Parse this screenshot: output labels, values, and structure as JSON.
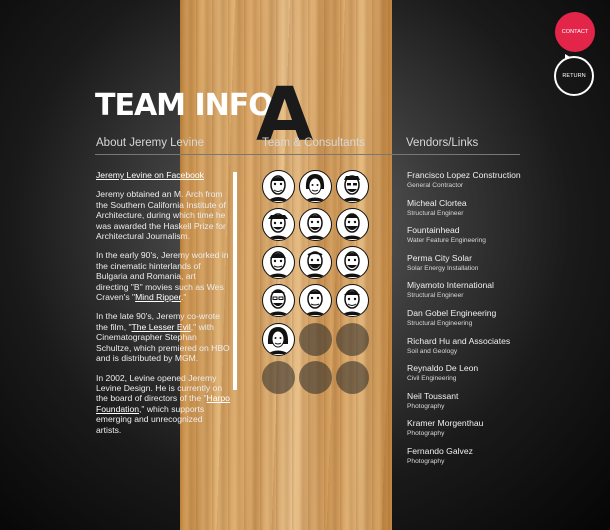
{
  "title": "TEAM INFO",
  "letter": "A",
  "columns": {
    "about": "About Jeremy Levine",
    "team": "Team & Consultants",
    "vendors": "Vendors/Links"
  },
  "about": {
    "facebook_link": "Jeremy Levine on Facebook",
    "p1": "Jeremy obtained an M. Arch from the Southern California Institute of Architecture, during which time he was awarded the Haskell Prize for Architectural Journalism.",
    "p2_a": "In the early 90's, Jeremy worked in the cinematic hinterlands of Bulgaria and Romania, art directing \"B\" movies such as Wes Craven's \"",
    "p2_link": "Mind Ripper",
    "p2_b": ".\"",
    "p3_a": "In the late 90's, Jeremy co-wrote the film, \"",
    "p3_link": "The Lesser Evil",
    "p3_b": ",\" with Cinematographer Stephan Schultze, which premiered on HBO and is distributed by MGM.",
    "p4_a": "In 2002, Levine opened Jeremy Levine Design.  He is currently on the board of directors of the \"",
    "p4_link": "Harpo Foundation",
    "p4_b": ",\" which supports emerging and unrecognized artists."
  },
  "vendors": [
    {
      "name": "Francisco Lopez Construction",
      "role": "General Contractor"
    },
    {
      "name": "Micheal Clortea",
      "role": "Structural Engineer"
    },
    {
      "name": "Fountainhead",
      "role": "Water Feature Engineering"
    },
    {
      "name": "Perma City Solar",
      "role": "Solar Energy Installation"
    },
    {
      "name": "Miyamoto International",
      "role": "Structural Engineer"
    },
    {
      "name": "Dan Gobel Engineering",
      "role": "Structural Engineering"
    },
    {
      "name": "Richard Hu and Associates",
      "role": "Soil and Geology"
    },
    {
      "name": "Reynaldo De Leon",
      "role": "Civil Engineering"
    },
    {
      "name": "Neil Toussant",
      "role": "Photography"
    },
    {
      "name": "Kramer Morgenthau",
      "role": "Photography"
    },
    {
      "name": "Fernando Galvez",
      "role": "Photography"
    }
  ],
  "buttons": {
    "contact": "CONTACT",
    "return": "RETURN"
  },
  "icons": {
    "return": "circular-return-arrow-icon"
  },
  "colors": {
    "contact_button": "#e4254a",
    "background": "#1a1a1a",
    "wood": "#dcae70"
  }
}
